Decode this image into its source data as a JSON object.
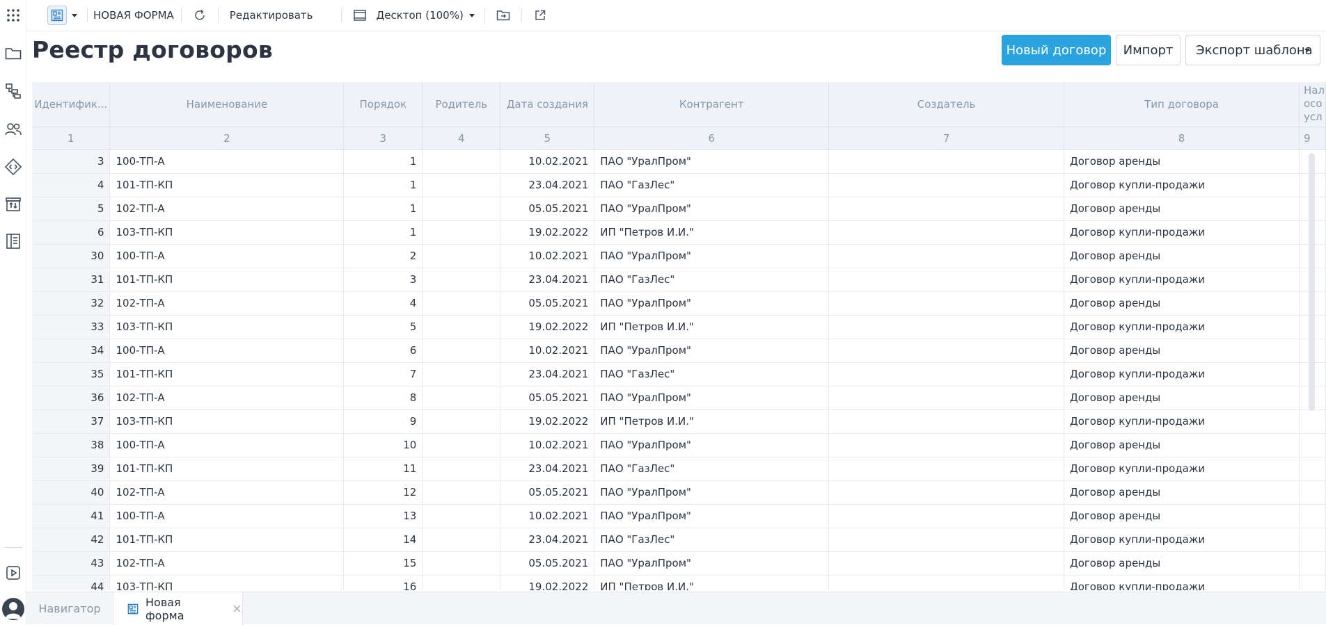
{
  "toolbar": {
    "form_name": "НОВАЯ ФОРМА",
    "edit_label": "Редактировать",
    "view_mode": "Десктоп (100%)"
  },
  "page": {
    "title": "Реестр договоров"
  },
  "actions": {
    "new_contract": "Новый договор",
    "import": "Импорт",
    "export_template": "Экспорт шаблона"
  },
  "table": {
    "headers": [
      "Идентифик...",
      "Наименование",
      "Порядок",
      "Родитель",
      "Дата создания",
      "Контрагент",
      "Создатель",
      "Тип договора",
      "Нал осо усл"
    ],
    "column_numbers": [
      "1",
      "2",
      "3",
      "4",
      "5",
      "6",
      "7",
      "8",
      "9"
    ],
    "rows": [
      {
        "id": "3",
        "name": "100-ТП-А",
        "order": "1",
        "parent": "",
        "date": "10.02.2021",
        "counterparty": "ПАО \"УралПром\"",
        "creator": "",
        "type": "Договор аренды"
      },
      {
        "id": "4",
        "name": "101-ТП-КП",
        "order": "1",
        "parent": "",
        "date": "23.04.2021",
        "counterparty": "ПАО \"ГазЛес\"",
        "creator": "",
        "type": "Договор купли-продажи"
      },
      {
        "id": "5",
        "name": "102-ТП-А",
        "order": "1",
        "parent": "",
        "date": "05.05.2021",
        "counterparty": "ПАО \"УралПром\"",
        "creator": "",
        "type": "Договор аренды"
      },
      {
        "id": "6",
        "name": "103-ТП-КП",
        "order": "1",
        "parent": "",
        "date": "19.02.2022",
        "counterparty": "ИП \"Петров И.И.\"",
        "creator": "",
        "type": "Договор купли-продажи"
      },
      {
        "id": "30",
        "name": "100-ТП-А",
        "order": "2",
        "parent": "",
        "date": "10.02.2021",
        "counterparty": "ПАО \"УралПром\"",
        "creator": "",
        "type": "Договор аренды"
      },
      {
        "id": "31",
        "name": "101-ТП-КП",
        "order": "3",
        "parent": "",
        "date": "23.04.2021",
        "counterparty": "ПАО \"ГазЛес\"",
        "creator": "",
        "type": "Договор купли-продажи"
      },
      {
        "id": "32",
        "name": "102-ТП-А",
        "order": "4",
        "parent": "",
        "date": "05.05.2021",
        "counterparty": "ПАО \"УралПром\"",
        "creator": "",
        "type": "Договор аренды"
      },
      {
        "id": "33",
        "name": "103-ТП-КП",
        "order": "5",
        "parent": "",
        "date": "19.02.2022",
        "counterparty": "ИП \"Петров И.И.\"",
        "creator": "",
        "type": "Договор купли-продажи"
      },
      {
        "id": "34",
        "name": "100-ТП-А",
        "order": "6",
        "parent": "",
        "date": "10.02.2021",
        "counterparty": "ПАО \"УралПром\"",
        "creator": "",
        "type": "Договор аренды"
      },
      {
        "id": "35",
        "name": "101-ТП-КП",
        "order": "7",
        "parent": "",
        "date": "23.04.2021",
        "counterparty": "ПАО \"ГазЛес\"",
        "creator": "",
        "type": "Договор купли-продажи"
      },
      {
        "id": "36",
        "name": "102-ТП-А",
        "order": "8",
        "parent": "",
        "date": "05.05.2021",
        "counterparty": "ПАО \"УралПром\"",
        "creator": "",
        "type": "Договор аренды"
      },
      {
        "id": "37",
        "name": "103-ТП-КП",
        "order": "9",
        "parent": "",
        "date": "19.02.2022",
        "counterparty": "ИП \"Петров И.И.\"",
        "creator": "",
        "type": "Договор купли-продажи"
      },
      {
        "id": "38",
        "name": "100-ТП-А",
        "order": "10",
        "parent": "",
        "date": "10.02.2021",
        "counterparty": "ПАО \"УралПром\"",
        "creator": "",
        "type": "Договор аренды"
      },
      {
        "id": "39",
        "name": "101-ТП-КП",
        "order": "11",
        "parent": "",
        "date": "23.04.2021",
        "counterparty": "ПАО \"ГазЛес\"",
        "creator": "",
        "type": "Договор купли-продажи"
      },
      {
        "id": "40",
        "name": "102-ТП-А",
        "order": "12",
        "parent": "",
        "date": "05.05.2021",
        "counterparty": "ПАО \"УралПром\"",
        "creator": "",
        "type": "Договор аренды"
      },
      {
        "id": "41",
        "name": "100-ТП-А",
        "order": "13",
        "parent": "",
        "date": "10.02.2021",
        "counterparty": "ПАО \"УралПром\"",
        "creator": "",
        "type": "Договор аренды"
      },
      {
        "id": "42",
        "name": "101-ТП-КП",
        "order": "14",
        "parent": "",
        "date": "23.04.2021",
        "counterparty": "ПАО \"ГазЛес\"",
        "creator": "",
        "type": "Договор купли-продажи"
      },
      {
        "id": "43",
        "name": "102-ТП-А",
        "order": "15",
        "parent": "",
        "date": "05.05.2021",
        "counterparty": "ПАО \"УралПром\"",
        "creator": "",
        "type": "Договор аренды"
      },
      {
        "id": "44",
        "name": "103-ТП-КП",
        "order": "16",
        "parent": "",
        "date": "19.02.2022",
        "counterparty": "ИП \"Петров И.И.\"",
        "creator": "",
        "type": "Договор купли-продажи"
      }
    ]
  },
  "tabs": {
    "navigator": "Навигатор",
    "current_form": "Новая форма"
  },
  "rail": {
    "icons": [
      "apps-grid-icon",
      "folder-icon",
      "hierarchy-icon",
      "users-icon",
      "code-diamond-icon",
      "archive-transfer-icon",
      "book-icon",
      "play-icon",
      "user-avatar-icon"
    ]
  },
  "colors": {
    "accent": "#2aa3df",
    "header_bg": "#eff2f6",
    "header_text": "#8797ab"
  }
}
